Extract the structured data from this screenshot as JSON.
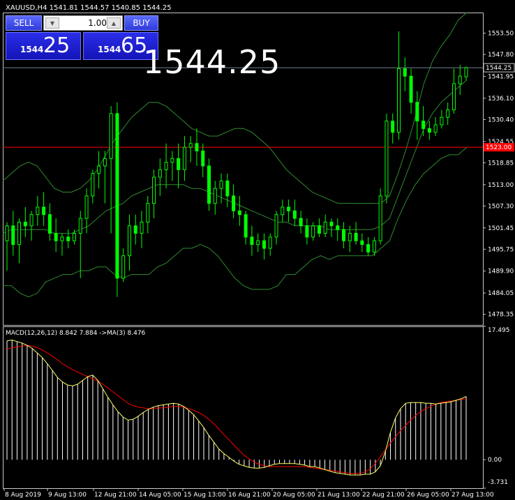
{
  "header": {
    "text": "XAUUSD,H4  1541.81 1544.57 1540.85 1544.25"
  },
  "trade_panel": {
    "sell_label": "SELL",
    "buy_label": "BUY",
    "lot_value": "1.00",
    "sell_small": "1544",
    "sell_big": "25",
    "buy_small": "1544",
    "buy_big": "65"
  },
  "big_price": "1544.25",
  "colors": {
    "candle": "#00ff00",
    "bands": "#2e8b2e",
    "ask_line": "#708090",
    "alert_line": "#ff0000",
    "macd_hist": "#ffffff",
    "macd_signal": "#ff0000",
    "macd_line": "#ffff66"
  },
  "chart_data": [
    {
      "type": "candlestick",
      "symbol": "XAUUSD",
      "timeframe": "H4",
      "indicator": "Bollinger Bands",
      "ylim": [
        1475.5,
        1559.0
      ],
      "y_ticks": [
        "1553.50",
        "1547.80",
        "1541.95",
        "1536.10",
        "1530.40",
        "1524.55",
        "1518.85",
        "1513.00",
        "1507.30",
        "1501.45",
        "1495.75",
        "1489.90",
        "1484.05",
        "1478.35"
      ],
      "current_price": "1544.25",
      "alert_price": "1523.00",
      "alert_label": "1523.00",
      "candles": [
        [
          1498,
          1503,
          1490,
          1502
        ],
        [
          1502,
          1506,
          1494,
          1497
        ],
        [
          1497,
          1504,
          1492,
          1503
        ],
        [
          1503,
          1507,
          1499,
          1502
        ],
        [
          1502,
          1506,
          1498,
          1505
        ],
        [
          1505,
          1510,
          1502,
          1507
        ],
        [
          1507,
          1511,
          1502,
          1505
        ],
        [
          1505,
          1508,
          1498,
          1500
        ],
        [
          1500,
          1504,
          1495,
          1498
        ],
        [
          1498,
          1500,
          1494,
          1499
        ],
        [
          1499,
          1501,
          1496,
          1498
        ],
        [
          1498,
          1501,
          1497,
          1500
        ],
        [
          1500,
          1506,
          1488,
          1504
        ],
        [
          1504,
          1512,
          1500,
          1510
        ],
        [
          1510,
          1517,
          1508,
          1516
        ],
        [
          1516,
          1522,
          1512,
          1518
        ],
        [
          1518,
          1522,
          1508,
          1520
        ],
        [
          1520,
          1534,
          1500,
          1532
        ],
        [
          1532,
          1535,
          1483,
          1488
        ],
        [
          1488,
          1496,
          1487,
          1494
        ],
        [
          1494,
          1505,
          1490,
          1502
        ],
        [
          1502,
          1505,
          1497,
          1500
        ],
        [
          1500,
          1506,
          1496,
          1503
        ],
        [
          1503,
          1510,
          1500,
          1508
        ],
        [
          1508,
          1517,
          1504,
          1515
        ],
        [
          1515,
          1520,
          1510,
          1517
        ],
        [
          1517,
          1524,
          1512,
          1519
        ],
        [
          1519,
          1522,
          1514,
          1520
        ],
        [
          1520,
          1524,
          1512,
          1517
        ],
        [
          1517,
          1526,
          1514,
          1523
        ],
        [
          1523,
          1526,
          1519,
          1524
        ],
        [
          1524,
          1528,
          1518,
          1522
        ],
        [
          1522,
          1524,
          1515,
          1518
        ],
        [
          1518,
          1520,
          1506,
          1508
        ],
        [
          1508,
          1514,
          1505,
          1512
        ],
        [
          1512,
          1516,
          1508,
          1514
        ],
        [
          1514,
          1516,
          1507,
          1510
        ],
        [
          1510,
          1513,
          1504,
          1506
        ],
        [
          1506,
          1510,
          1502,
          1505
        ],
        [
          1505,
          1506,
          1497,
          1499
        ],
        [
          1499,
          1502,
          1494,
          1497
        ],
        [
          1497,
          1500,
          1495,
          1498
        ],
        [
          1498,
          1500,
          1493,
          1496
        ],
        [
          1496,
          1500,
          1494,
          1499
        ],
        [
          1499,
          1506,
          1497,
          1505
        ],
        [
          1505,
          1509,
          1503,
          1507
        ],
        [
          1507,
          1509,
          1503,
          1506
        ],
        [
          1506,
          1509,
          1502,
          1504
        ],
        [
          1504,
          1506,
          1500,
          1502
        ],
        [
          1502,
          1504,
          1497,
          1499
        ],
        [
          1499,
          1503,
          1498,
          1502
        ],
        [
          1502,
          1504,
          1499,
          1500
        ],
        [
          1500,
          1505,
          1499,
          1503
        ],
        [
          1503,
          1504,
          1499,
          1502
        ],
        [
          1502,
          1504,
          1498,
          1501
        ],
        [
          1501,
          1503,
          1496,
          1498
        ],
        [
          1498,
          1502,
          1495,
          1500
        ],
        [
          1500,
          1503,
          1497,
          1498
        ],
        [
          1498,
          1500,
          1495,
          1497
        ],
        [
          1497,
          1499,
          1494,
          1495
        ],
        [
          1495,
          1499,
          1494,
          1498
        ],
        [
          1498,
          1512,
          1497,
          1510
        ],
        [
          1510,
          1532,
          1508,
          1530
        ],
        [
          1530,
          1532,
          1524,
          1527
        ],
        [
          1527,
          1554,
          1525,
          1544
        ],
        [
          1544,
          1547,
          1538,
          1542
        ],
        [
          1542,
          1544,
          1532,
          1535
        ],
        [
          1535,
          1538,
          1525,
          1530
        ],
        [
          1530,
          1534,
          1526,
          1528
        ],
        [
          1528,
          1530,
          1525,
          1527
        ],
        [
          1527,
          1531,
          1526,
          1529
        ],
        [
          1529,
          1533,
          1528,
          1531
        ],
        [
          1531,
          1535,
          1529,
          1533
        ],
        [
          1533,
          1544,
          1532,
          1540
        ],
        [
          1540,
          1545,
          1537,
          1542
        ],
        [
          1541.81,
          1544.57,
          1540.85,
          1544.25
        ]
      ],
      "bb_upper": [
        1514,
        1516,
        1518,
        1519,
        1518,
        1515,
        1512,
        1511,
        1511,
        1512,
        1514,
        1517,
        1521,
        1525,
        1528,
        1531,
        1533,
        1535,
        1535,
        1534,
        1532,
        1530,
        1528,
        1527,
        1526,
        1526,
        1527,
        1528,
        1528,
        1527,
        1525,
        1523,
        1520,
        1517,
        1515,
        1513,
        1511,
        1510,
        1509,
        1508,
        1508,
        1508,
        1508,
        1508,
        1508,
        1510,
        1516,
        1523,
        1531,
        1540,
        1546,
        1550,
        1553,
        1557,
        1559
      ],
      "bb_middle": [
        1500,
        1501,
        1501,
        1501,
        1501,
        1501,
        1500,
        1500,
        1500,
        1501,
        1502,
        1504,
        1506,
        1507,
        1508,
        1510,
        1511,
        1512,
        1513,
        1513,
        1513,
        1513,
        1512,
        1512,
        1511,
        1510,
        1509,
        1508,
        1507,
        1506,
        1505,
        1504,
        1503,
        1503,
        1502,
        1502,
        1502,
        1502,
        1501,
        1501,
        1501,
        1501,
        1501,
        1501,
        1502,
        1504,
        1510,
        1516,
        1522,
        1528,
        1532,
        1535,
        1537,
        1539,
        1541
      ],
      "bb_lower": [
        1486,
        1486,
        1484,
        1483,
        1484,
        1487,
        1488,
        1489,
        1489,
        1490,
        1490,
        1491,
        1491,
        1489,
        1488,
        1489,
        1489,
        1489,
        1491,
        1492,
        1494,
        1496,
        1496,
        1497,
        1496,
        1494,
        1491,
        1488,
        1486,
        1485,
        1485,
        1485,
        1486,
        1489,
        1489,
        1491,
        1493,
        1494,
        1493,
        1494,
        1494,
        1494,
        1494,
        1494,
        1496,
        1498,
        1504,
        1509,
        1513,
        1516,
        1518,
        1520,
        1521,
        1521,
        1523
      ]
    },
    {
      "type": "bar+line",
      "title": "MACD(12,26,12) 8.842 7.884  ->MA(3) 8.476",
      "ylim": [
        -3.731,
        17.495
      ],
      "y_ticks": [
        "17.495",
        "0.00",
        "-3.731"
      ],
      "x_ticks": [
        "8 Aug 2019",
        "9 Aug 13:00",
        "12 Aug 21:00",
        "14 Aug 05:00",
        "15 Aug 13:00",
        "16 Aug 21:00",
        "20 Aug 05:00",
        "21 Aug 13:00",
        "22 Aug 21:00",
        "26 Aug 05:00",
        "27 Aug 13:00"
      ],
      "macd": [
        15.6,
        15.7,
        15.5,
        15.3,
        15.0,
        14.6,
        14.0,
        13.4,
        12.6,
        11.7,
        10.8,
        10.2,
        9.8,
        9.7,
        9.9,
        10.4,
        10.9,
        11.1,
        10.4,
        9.3,
        8.2,
        7.2,
        6.3,
        5.6,
        5.2,
        5.3,
        5.7,
        6.2,
        6.6,
        6.9,
        7.1,
        7.2,
        7.3,
        7.4,
        7.3,
        7.0,
        6.5,
        5.9,
        5.1,
        4.2,
        3.2,
        2.3,
        1.4,
        0.8,
        0.3,
        -0.2,
        -0.6,
        -0.8,
        -1.0,
        -1.1,
        -1.1,
        -1.0,
        -0.8,
        -0.6,
        -0.5,
        -0.5,
        -0.5,
        -0.5,
        -0.6,
        -0.7,
        -0.9,
        -0.9,
        -1.1,
        -1.3,
        -1.5,
        -1.7,
        -1.8,
        -1.9,
        -2.0,
        -2.0,
        -2.0,
        -1.9,
        -1.9,
        -1.6,
        -0.8,
        1.1,
        3.6,
        5.5,
        6.7,
        7.4,
        7.5,
        7.5,
        7.5,
        7.4,
        7.4,
        7.3,
        7.4,
        7.5,
        7.6,
        7.8,
        8.0,
        8.3
      ],
      "signal": [
        14.5,
        14.7,
        14.8,
        14.9,
        15.0,
        14.9,
        14.7,
        14.4,
        14.0,
        13.6,
        13.1,
        12.6,
        12.2,
        11.8,
        11.5,
        11.2,
        10.9,
        10.6,
        10.3,
        9.9,
        9.4,
        8.9,
        8.4,
        7.9,
        7.4,
        7.1,
        6.9,
        6.8,
        6.7,
        6.7,
        6.8,
        6.8,
        6.9,
        7.0,
        7.0,
        6.9,
        6.7,
        6.5,
        6.2,
        5.8,
        5.3,
        4.7,
        4.0,
        3.3,
        2.6,
        1.9,
        1.2,
        0.6,
        0.1,
        -0.3,
        -0.6,
        -0.8,
        -0.9,
        -0.9,
        -0.9,
        -0.9,
        -0.9,
        -0.9,
        -0.9,
        -0.9,
        -1.0,
        -1.1,
        -1.2,
        -1.3,
        -1.4,
        -1.5,
        -1.6,
        -1.7,
        -1.8,
        -1.8,
        -1.8,
        -1.6,
        -1.2,
        -0.5,
        0.4,
        1.3,
        2.2,
        3.0,
        3.8,
        4.5,
        5.2,
        5.8,
        6.3,
        6.7,
        7.0,
        7.3,
        7.5,
        7.6,
        7.7,
        7.8,
        7.9,
        8.0
      ]
    }
  ]
}
